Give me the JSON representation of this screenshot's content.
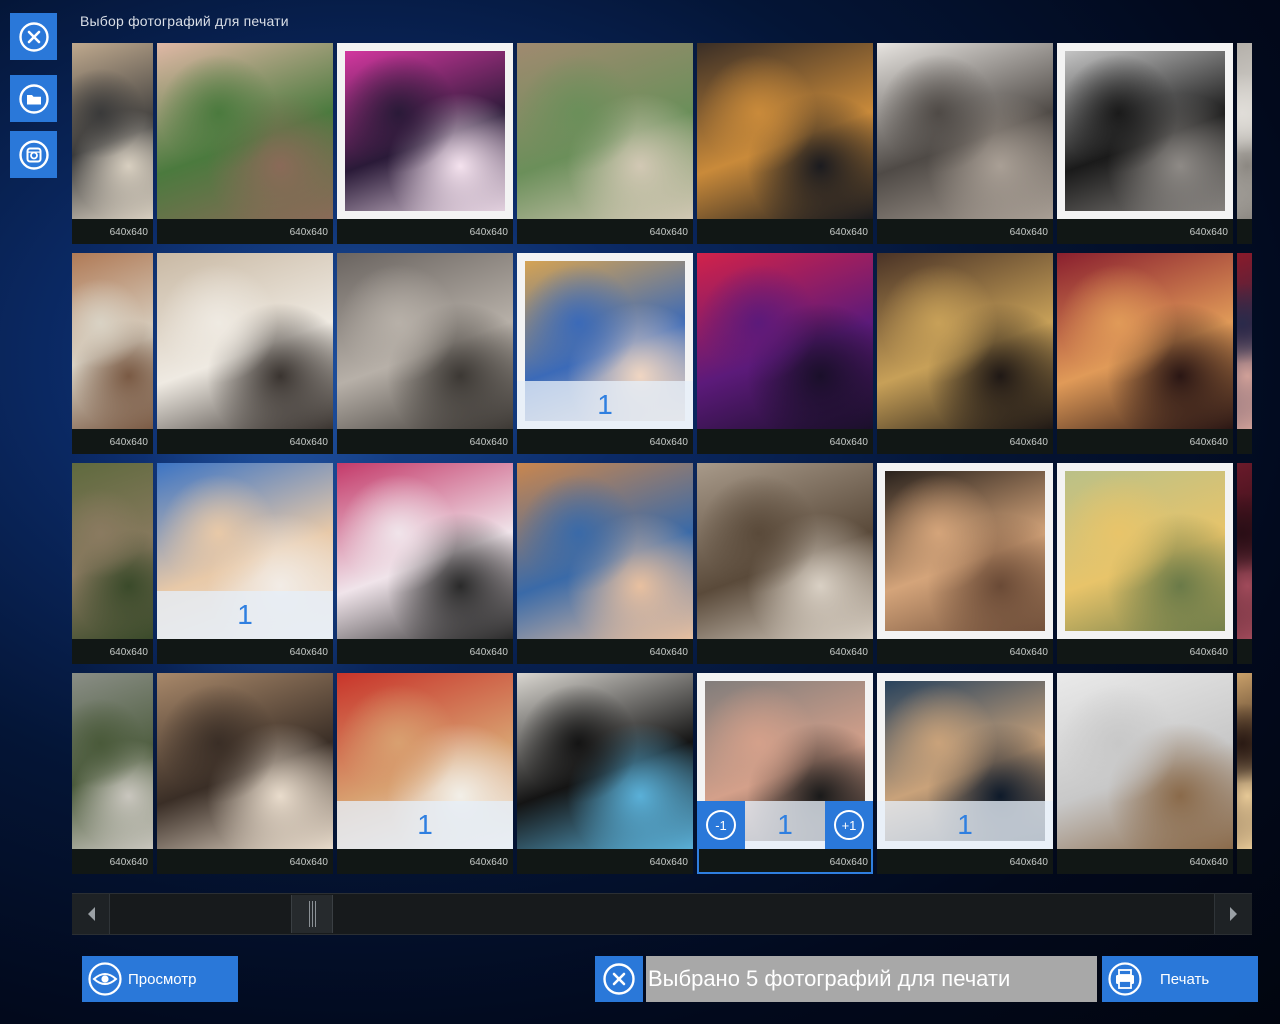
{
  "window": {
    "title": "Выбор фотографий для печати"
  },
  "colors": {
    "accent": "#2a78d9",
    "count_text": "#2f7fe0",
    "tile_bg": "#111715",
    "status_bg": "#a8a8a8"
  },
  "side_buttons": [
    {
      "name": "close-button",
      "icon": "close-circle-icon"
    },
    {
      "name": "folder-button",
      "icon": "folder-icon"
    },
    {
      "name": "instagram-button",
      "icon": "instagram-icon"
    }
  ],
  "photos": [
    {
      "size": "640x640",
      "count": "",
      "colors": [
        "#bfa98e",
        "#3a3a3a",
        "#d8cfc0"
      ],
      "partial": "left"
    },
    {
      "size": "640x640",
      "count": "",
      "colors": [
        "#e0b8a6",
        "#4b7a3e",
        "#8a6a58"
      ]
    },
    {
      "size": "640x640",
      "count": "",
      "colors": [
        "#e23aa8",
        "#2a1a38",
        "#f4e2ee"
      ],
      "framed": true
    },
    {
      "size": "640x640",
      "count": "",
      "colors": [
        "#a08a70",
        "#6b8f5a",
        "#d2c8b4"
      ]
    },
    {
      "size": "640x640",
      "count": "",
      "colors": [
        "#3a2e26",
        "#c98a3a",
        "#1b1b1f"
      ]
    },
    {
      "size": "640x640",
      "count": "",
      "colors": [
        "#e7e4e0",
        "#4f4a46",
        "#a99f95"
      ]
    },
    {
      "size": "640x640",
      "count": "",
      "colors": [
        "#d3d3d3",
        "#1a1a1a",
        "#8e8a86"
      ],
      "framed": true
    },
    {
      "size": "",
      "count": "",
      "colors": [
        "#b4b0aa",
        "#e0ddd8",
        "#8c8882"
      ],
      "partial": "right"
    },
    {
      "size": "640x640",
      "count": "",
      "colors": [
        "#b07a56",
        "#d9d2c4",
        "#7a5a44"
      ],
      "partial": "left"
    },
    {
      "size": "640x640",
      "count": "",
      "colors": [
        "#c9b9a4",
        "#efeae2",
        "#3a3430"
      ]
    },
    {
      "size": "640x640",
      "count": "",
      "colors": [
        "#6a6460",
        "#b7b0a8",
        "#3c3834"
      ]
    },
    {
      "size": "640x640",
      "count": "1",
      "colors": [
        "#e3a84a",
        "#3b6ab8",
        "#f0d6c2"
      ],
      "framed": true
    },
    {
      "size": "640x640",
      "count": "",
      "colors": [
        "#d2224a",
        "#5c1a7a",
        "#1a0f2a"
      ]
    },
    {
      "size": "640x640",
      "count": "",
      "colors": [
        "#4a3326",
        "#c7a058",
        "#1f1815"
      ]
    },
    {
      "size": "640x640",
      "count": "",
      "colors": [
        "#8a1f2e",
        "#e09a58",
        "#2a1614"
      ]
    },
    {
      "size": "",
      "count": "",
      "colors": [
        "#8a1a2a",
        "#2a2a4a",
        "#d0a098"
      ],
      "partial": "right"
    },
    {
      "size": "640x640",
      "count": "",
      "colors": [
        "#5f6a3e",
        "#8a7a60",
        "#3a4a2a"
      ],
      "partial": "left"
    },
    {
      "size": "640x640",
      "count": "1",
      "colors": [
        "#3c74c4",
        "#e8c9a8",
        "#f2ece6"
      ]
    },
    {
      "size": "640x640",
      "count": "",
      "colors": [
        "#c43a6a",
        "#f0e4ea",
        "#2a2a2a"
      ]
    },
    {
      "size": "640x640",
      "count": "",
      "colors": [
        "#c9864e",
        "#3a6aa8",
        "#e8c0a0"
      ]
    },
    {
      "size": "640x640",
      "count": "",
      "colors": [
        "#a89a8a",
        "#5a4a3a",
        "#d9d0c4"
      ]
    },
    {
      "size": "640x640",
      "count": "",
      "colors": [
        "#1a1614",
        "#d4a47a",
        "#6a4a36"
      ],
      "framed": true
    },
    {
      "size": "640x640",
      "count": "",
      "colors": [
        "#b6c08a",
        "#e8c46a",
        "#6a7a48"
      ],
      "framed": true
    },
    {
      "size": "",
      "count": "",
      "colors": [
        "#6a1a2a",
        "#2a0e16",
        "#a04a5a"
      ],
      "partial": "right"
    },
    {
      "size": "640x640",
      "count": "",
      "colors": [
        "#8a8e86",
        "#4a5a3a",
        "#c9c6be"
      ],
      "partial": "left"
    },
    {
      "size": "640x640",
      "count": "",
      "colors": [
        "#a8886a",
        "#3a2e26",
        "#e9dccc"
      ]
    },
    {
      "size": "640x640",
      "count": "1",
      "colors": [
        "#c8342a",
        "#d8a070",
        "#f2efe8"
      ]
    },
    {
      "size": "640x640",
      "count": "",
      "colors": [
        "#d9d6d0",
        "#141414",
        "#5ab0d8"
      ]
    },
    {
      "size": "640x640",
      "count": "1",
      "colors": [
        "#7a7a7a",
        "#d4a08a",
        "#1a1a1a"
      ],
      "framed": true,
      "active": true,
      "minus": "-1",
      "plus": "+1"
    },
    {
      "size": "640x640",
      "count": "1",
      "colors": [
        "#1a3a5a",
        "#c9a27a",
        "#0e1a2a"
      ],
      "framed": true
    },
    {
      "size": "640x640",
      "count": "",
      "colors": [
        "#eaeaea",
        "#c8c8c8",
        "#8a6a4a"
      ]
    },
    {
      "size": "",
      "count": "",
      "colors": [
        "#c9a06a",
        "#2a1a14",
        "#e6c896"
      ],
      "partial": "right"
    }
  ],
  "bottom_bar": {
    "preview_label": "Просмотр",
    "status_text": "Выбрано 5 фотографий для печати",
    "print_label": "Печать"
  }
}
